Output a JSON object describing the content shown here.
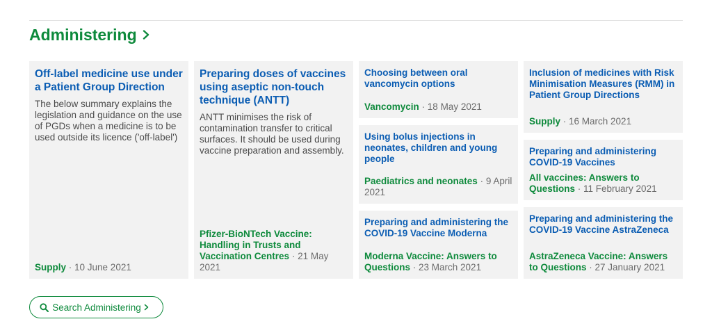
{
  "section": {
    "title": "Administering",
    "search_label": "Search Administering"
  },
  "cards": [
    {
      "title": "Off-label medicine use under a Patient Group Direction",
      "description": "The below summary explains the legislation and guidance on the use of PGDs when a medicine is to be used outside its licence ('off-label')",
      "tag": "Supply",
      "date": "10 June 2021"
    },
    {
      "title": "Preparing doses of vaccines using aseptic non-touch technique (ANTT)",
      "description": "ANTT minimises the risk of contamination transfer to critical surfaces. It should be used during vaccine preparation and assembly.",
      "tag": "Pfizer-BioNTech Vaccine: Handling in Trusts and Vaccination Centres",
      "date": "21 May 2021"
    },
    {
      "title": "Choosing between oral vancomycin options",
      "tag": "Vancomycin",
      "date": "18 May 2021"
    },
    {
      "title": "Using bolus injections in neonates, children and young people",
      "tag": "Paediatrics and neonates",
      "date": "9 April 2021"
    },
    {
      "title": "Preparing and administering the COVID-19 Vaccine Moderna",
      "tag": "Moderna Vaccine: Answers to Questions",
      "date": "23 March 2021"
    },
    {
      "title": "Inclusion of medicines with Risk Minimisation Measures (RMM) in Patient Group Directions",
      "tag": "Supply",
      "date": "16 March 2021"
    },
    {
      "title": "Preparing and administering COVID-19 Vaccines",
      "tag": "All vaccines: Answers to Questions",
      "date": "11 February 2021"
    },
    {
      "title": "Preparing and administering the COVID-19 Vaccine AstraZeneca",
      "tag": "AstraZeneca Vaccine: Answers to Questions",
      "date": "27 January 2021"
    }
  ],
  "meta_separator": " · ",
  "colors": {
    "accent_green": "#0e8a3c",
    "link_blue": "#0b5db3",
    "card_bg": "#f2f2f2"
  }
}
